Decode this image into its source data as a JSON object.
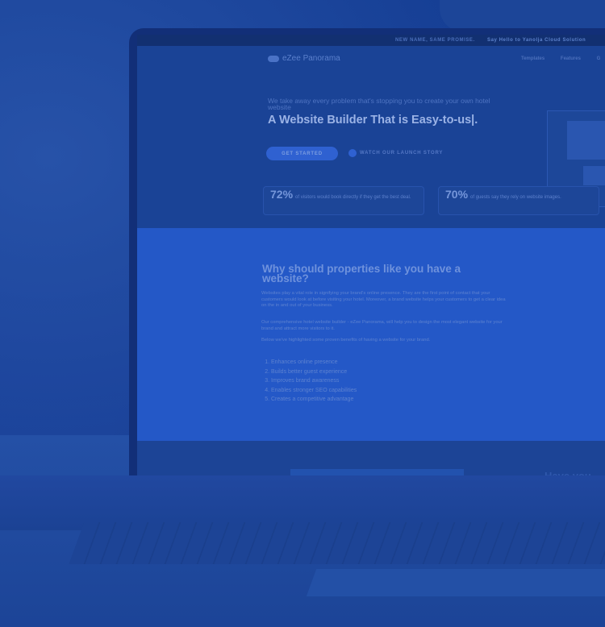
{
  "topbar": {
    "promo_left": "NEW NAME, SAME PROMISE.",
    "promo_right": "Say Hello to Yanolja Cloud Solution"
  },
  "nav": {
    "logo_text": "eZee Panorama",
    "links": [
      "Templates",
      "Features",
      "G"
    ]
  },
  "hero": {
    "subtitle": "We take away every problem that's stopping you to create your own hotel website",
    "title": "A Website Builder That is Easy-to-us|.",
    "cta_primary": "GET STARTED",
    "cta_video": "WATCH OUR LAUNCH STORY"
  },
  "stats": [
    {
      "value": "72%",
      "text": "of visitors would book directly if they get the best deal."
    },
    {
      "value": "70%",
      "text": "of guests say they rely on website images."
    }
  ],
  "why": {
    "title": "Why should properties like you have a website?",
    "paragraphs": [
      "Websites play a vital role in signifying your brand's online presence. They are the first point of contact that your customers would look at before visiting your hotel. Moreover, a brand website helps your customers to get a clear idea on the in and out of your business.",
      "Our comprehensive hotel website builder - eZee Panorama, will help you to design the most elegant website for your brand and attract more visitors to it.",
      "Below we've highlighted some proven benefits of having a website for your brand."
    ],
    "benefits": [
      "Enhances online presence",
      "Builds better guest experience",
      "Improves brand awareness",
      "Enables stronger SEO capabilities",
      "Creates a competitive advantage"
    ]
  },
  "next_section": {
    "heading_partial": "Have you"
  }
}
